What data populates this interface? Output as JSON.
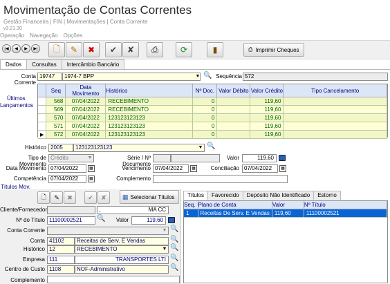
{
  "header": {
    "title": "Movimentação de Contas Correntes",
    "breadcrumb": "Gestão Financeira | FIN | Movimentações | Conta Corrente",
    "version": "v3.21.30"
  },
  "menu": [
    "Operação",
    "Navegação",
    "Opções"
  ],
  "toolbar": {
    "nav_labels": [
      "|◀",
      "◀",
      "▶",
      "▶|"
    ],
    "print_checks_label": "Imprimir Cheques"
  },
  "tabs": [
    "Dados",
    "Consultas",
    "Intercâmbio Bancário"
  ],
  "conta": {
    "label": "Conta Corrente",
    "code": "19747",
    "name": "1974-7 BPP",
    "sequencia_label": "Sequência",
    "sequencia": "572"
  },
  "ultimos": {
    "label_line1": "Últimos",
    "label_line2": "Lançamentos",
    "columns": [
      "Seq",
      "Data Movimento",
      "Histórico",
      "Nº Doc.",
      "Valor Débito",
      "Valor Crédito",
      "Tipo Cancelamento"
    ],
    "rows": [
      {
        "seq": "568",
        "data": "07/04/2022",
        "hist": "RECEBIMENTO",
        "doc": "0",
        "debito": "",
        "credito": "119,60",
        "tipo": ""
      },
      {
        "seq": "569",
        "data": "07/04/2022",
        "hist": "RECEBIMENTO",
        "doc": "0",
        "debito": "",
        "credito": "119,60",
        "tipo": ""
      },
      {
        "seq": "570",
        "data": "07/04/2022",
        "hist": "123123123123",
        "doc": "0",
        "debito": "",
        "credito": "119,60",
        "tipo": ""
      },
      {
        "seq": "571",
        "data": "07/04/2022",
        "hist": "123123123123",
        "doc": "0",
        "debito": "",
        "credito": "119,60",
        "tipo": ""
      },
      {
        "seq": "572",
        "data": "07/04/2022",
        "hist": "123123123123",
        "doc": "0",
        "debito": "",
        "credito": "119,60",
        "tipo": ""
      }
    ]
  },
  "form": {
    "historico_label": "Histórico",
    "historico_code": "2005",
    "historico_name": "123123123123",
    "tipo_mov_label": "Tipo de Movimento",
    "tipo_mov": "Crédito",
    "serie_label": "Série / Nº Documento",
    "valor_label": "Valor",
    "valor": "119,60",
    "data_mov_label": "Data Movimento",
    "data_mov": "07/04/2022",
    "vencimento_label": "Vencimento",
    "vencimento": "07/04/2022",
    "conciliacao_label": "Conciliação",
    "conciliacao": "07/04/2022",
    "competencia_label": "Competência",
    "competencia": "07/04/2022",
    "complemento_label": "Complemento",
    "complemento": ""
  },
  "titulos": {
    "section_label": "Títulos Mov.",
    "select_label": "Selecionar Títulos",
    "cliente_label": "Cliente/Fornecedor",
    "cliente_code": "",
    "cliente_sep": ",",
    "cliente_uf": "MA CC",
    "num_titulo_label": "Nº do Título",
    "num_titulo": "11100002521",
    "valor_label": "Valor",
    "valor": "119,60",
    "conta_corrente_label": "Conta Corrente",
    "conta_label": "Conta",
    "conta_code": "41102",
    "conta_name": "Receitas de Serv. E Vendas",
    "historico_label": "Histórico",
    "historico_code": "12",
    "historico_name": "RECEBIMENTO",
    "empresa_label": "Empresa",
    "empresa_code": "111",
    "empresa_name": "TRANSPORTES LTI",
    "centro_label": "Centro de Custo",
    "centro_code": "1108",
    "centro_name": "NOF-Administrativo",
    "complemento_label": "Complemento"
  },
  "right_tabs": [
    "Títulos",
    "Favorecido",
    "Depósito Não Identificado",
    "Estorno"
  ],
  "titulos_grid": {
    "columns": [
      "Seq.",
      "Plano de Conta",
      "Valor",
      "Nº Título"
    ],
    "rows": [
      {
        "seq": "1",
        "plano": "Receitas De Serv. E Vendas",
        "valor": "119,60",
        "titulo": "11100002521"
      }
    ]
  },
  "colors": {
    "accent": "#0a64d6",
    "header_bg": "#dbe6f7",
    "row_light": "#f3f7c8",
    "field_yellow": "#ffffe2"
  }
}
